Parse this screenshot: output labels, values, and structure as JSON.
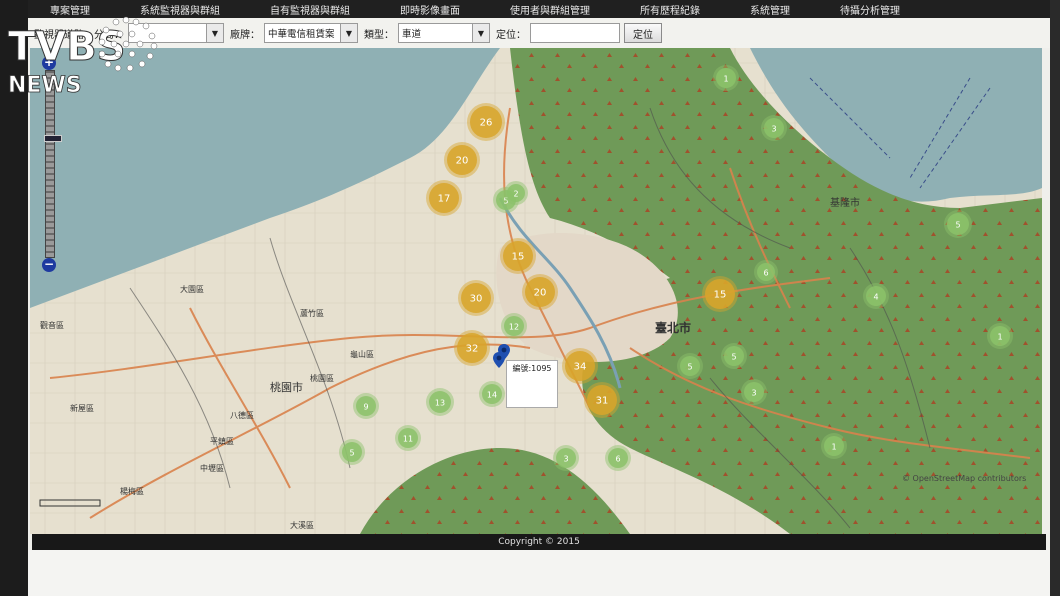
{
  "menu": {
    "items": [
      "專案管理",
      "系統監視器與群組",
      "自有監視器與群組",
      "即時影像畫面",
      "使用者與群組管理",
      "所有歷程紀錄",
      "系統管理",
      "待攝分析管理"
    ]
  },
  "filters": {
    "surveillance_label": "監視器道路 - 分局：",
    "district_value": "",
    "plate_label": "廠牌：",
    "plate_value": "中華電信租賃案",
    "type_label": "類型：",
    "type_value": "車道",
    "locate_label": "定位：",
    "locate_input_value": "",
    "locate_button": "定位"
  },
  "map": {
    "tooltip": "編號:1095",
    "attribution": "© OpenStreetMap contributors",
    "place_labels": [
      "臺北市",
      "基隆市",
      "桃園市",
      "大園區",
      "蘆竹區",
      "桃園區",
      "龜山區",
      "八德區",
      "平鎮區",
      "中壢區",
      "楊梅區",
      "觀音區",
      "新屋區",
      "大溪區"
    ],
    "clusters": [
      {
        "count": "26",
        "color": "#d8a52a"
      },
      {
        "count": "20",
        "color": "#d8a52a"
      },
      {
        "count": "17",
        "color": "#d8a52a"
      },
      {
        "count": "15",
        "color": "#d8a52a"
      },
      {
        "count": "30",
        "color": "#d8a52a"
      },
      {
        "count": "20",
        "color": "#d8a52a"
      },
      {
        "count": "32",
        "color": "#d8a52a"
      },
      {
        "count": "34",
        "color": "#d8a52a"
      },
      {
        "count": "31",
        "color": "#d8a52a"
      },
      {
        "count": "15",
        "color": "#d8a52a"
      },
      {
        "count": "1",
        "color": "#8cc26a"
      },
      {
        "count": "5",
        "color": "#8cc26a"
      },
      {
        "count": "12",
        "color": "#8cc26a"
      },
      {
        "count": "13",
        "color": "#8cc26a"
      },
      {
        "count": "14",
        "color": "#8cc26a"
      },
      {
        "count": "9",
        "color": "#8cc26a"
      },
      {
        "count": "11",
        "color": "#8cc26a"
      },
      {
        "count": "5",
        "color": "#8cc26a"
      },
      {
        "count": "3",
        "color": "#8cc26a"
      },
      {
        "count": "6",
        "color": "#8cc26a"
      },
      {
        "count": "5",
        "color": "#8cc26a"
      },
      {
        "count": "5",
        "color": "#8cc26a"
      },
      {
        "count": "3",
        "color": "#8cc26a"
      },
      {
        "count": "1",
        "color": "#8cc26a"
      },
      {
        "count": "5",
        "color": "#8cc26a"
      },
      {
        "count": "4",
        "color": "#8cc26a"
      },
      {
        "count": "1",
        "color": "#8cc26a"
      },
      {
        "count": "3",
        "color": "#8cc26a"
      },
      {
        "count": "2",
        "color": "#8cc26a"
      },
      {
        "count": "6",
        "color": "#8cc26a"
      }
    ],
    "colors": {
      "sea": "#8fb0b4",
      "land": "#e8e2d2",
      "forest": "#6f9a58",
      "road": "#d9824c"
    }
  },
  "footer": {
    "copyright": "Copyright © 2015"
  },
  "logo": {
    "line1": "TVBS",
    "line2": "NEWS"
  }
}
